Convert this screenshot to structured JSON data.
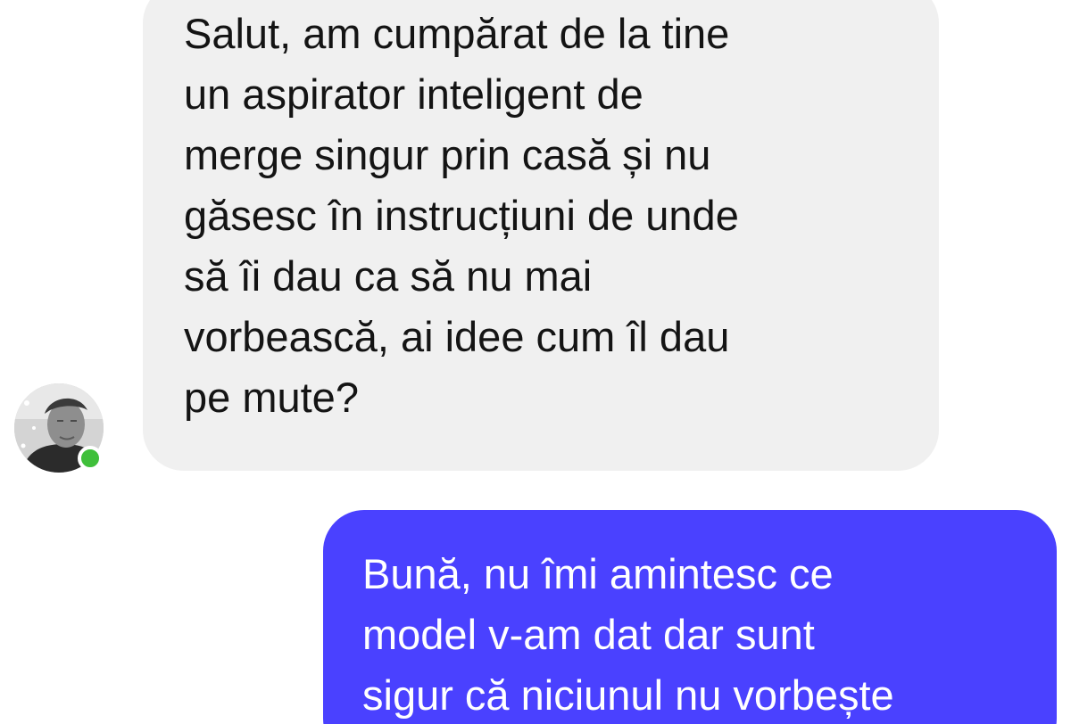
{
  "conversation": {
    "messages": [
      {
        "direction": "incoming",
        "text": "Salut, am cumpărat de la tine\nun aspirator inteligent de\nmerge singur prin casă și nu\ngăsesc în instrucțiuni de unde\nsă îi dau ca să nu mai\nvorbească, ai idee cum îl dau\npe mute?"
      },
      {
        "direction": "outgoing",
        "text": "Bună, nu îmi amintesc ce\nmodel v-am dat dar sunt\nsigur că niciunul nu vorbește"
      }
    ],
    "contact": {
      "online": true
    }
  },
  "colors": {
    "incoming_bubble": "#f0f0f0",
    "outgoing_bubble": "#4a41ff",
    "online_indicator": "#3fbf3a",
    "background": "#ffffff"
  },
  "icons": {
    "avatar": "contact-avatar",
    "presence": "online-status-dot"
  }
}
